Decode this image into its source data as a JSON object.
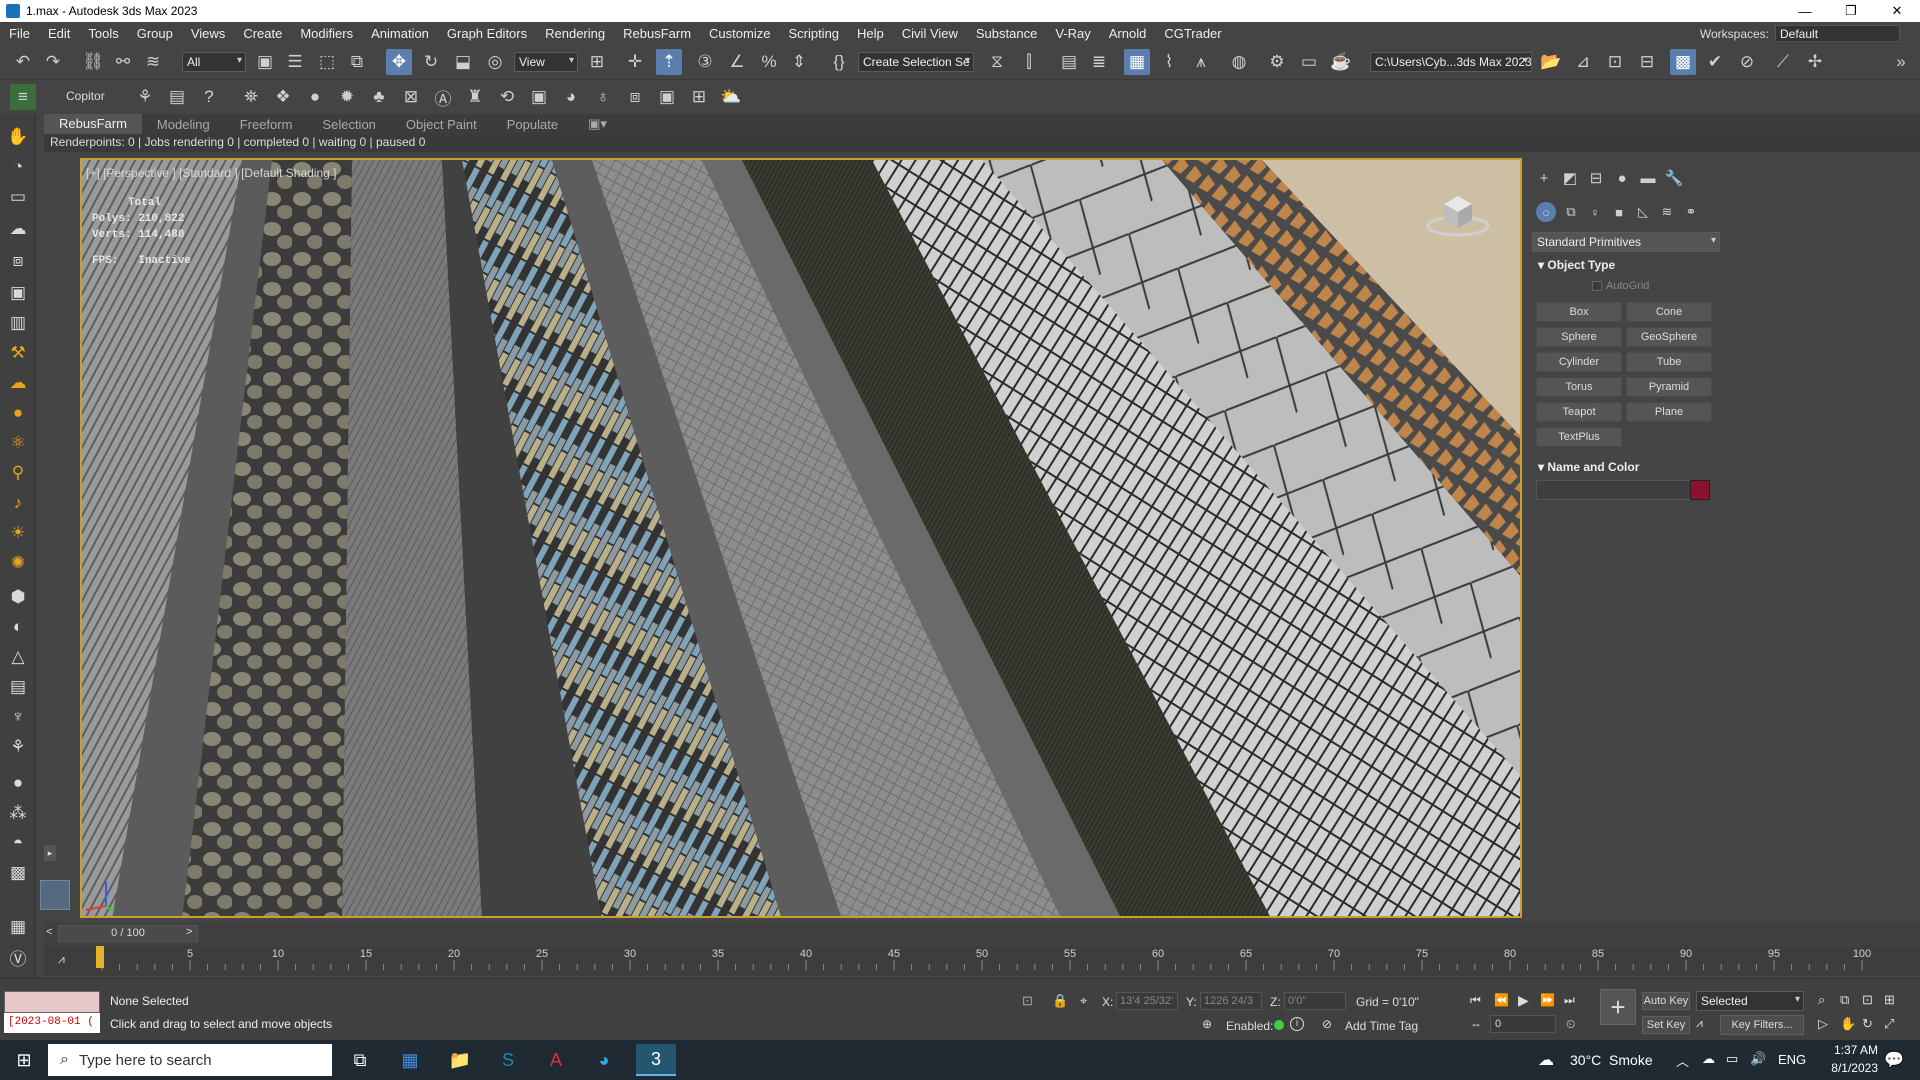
{
  "window": {
    "title": "1.max - Autodesk 3ds Max 2023",
    "minimize": "—",
    "restore": "❐",
    "close": "✕"
  },
  "menus": [
    "File",
    "Edit",
    "Tools",
    "Group",
    "Views",
    "Create",
    "Modifiers",
    "Animation",
    "Graph Editors",
    "Rendering",
    "RebusFarm",
    "Customize",
    "Scripting",
    "Help",
    "Civil View",
    "Substance",
    "V-Ray",
    "Arnold",
    "CGTrader"
  ],
  "workspace": {
    "label": "Workspaces:",
    "value": "Default"
  },
  "toolbar": {
    "selection_filter": "All",
    "ref_coord": "View",
    "named_selection": "Create Selection Se",
    "project_path": "C:\\Users\\Cyb...3ds Max 2023",
    "copitor": "Copitor"
  },
  "ribbon_tabs": [
    "RebusFarm",
    "Modeling",
    "Freeform",
    "Selection",
    "Object Paint",
    "Populate"
  ],
  "renderpoints_status": "Renderpoints: 0 | Jobs rendering 0 | completed 0 | waiting 0 | paused 0",
  "viewport": {
    "label": "[+] [Perspective ] [Standard ] [Default Shading ]",
    "stats": {
      "total_label": "Total",
      "polys_label": "Polys:",
      "polys": "210,822",
      "verts_label": "Verts:",
      "verts": "114,480",
      "fps_label": "FPS:",
      "fps": "Inactive"
    }
  },
  "command_panel": {
    "category": "Standard Primitives",
    "object_type_title": "Object Type",
    "autogrid": "AutoGrid",
    "buttons": [
      "Box",
      "Cone",
      "Sphere",
      "GeoSphere",
      "Cylinder",
      "Tube",
      "Torus",
      "Pyramid",
      "Teapot",
      "Plane",
      "TextPlus"
    ],
    "name_color_title": "Name and Color",
    "color_swatch": "#8a1030"
  },
  "timeline": {
    "frame_display": "0 / 100",
    "ticks": [
      0,
      5,
      10,
      15,
      20,
      25,
      30,
      35,
      40,
      45,
      50,
      55,
      60,
      65,
      70,
      75,
      80,
      85,
      90,
      95,
      100
    ]
  },
  "status": {
    "script_listener": "[2023-08-01 (",
    "selection": "None Selected",
    "prompt": "Click and drag to select and move objects",
    "x_label": "X:",
    "x_value": "13'4 25/32'",
    "y_label": "Y:",
    "y_value": "1226 24/3",
    "z_label": "Z:",
    "z_value": "0'0\"",
    "grid": "Grid = 0'10\"",
    "enabled_label": "Enabled:",
    "add_time_tag": "Add Time Tag",
    "auto_key": "Auto Key",
    "set_key": "Set Key",
    "selected_dropdown": "Selected",
    "key_filters": "Key Filters...",
    "frame_field": "0"
  },
  "taskbar": {
    "search_placeholder": "Type here to search",
    "weather": "30°C  Smoke",
    "language": "ENG",
    "time": "1:37 AM",
    "date": "8/1/2023"
  }
}
